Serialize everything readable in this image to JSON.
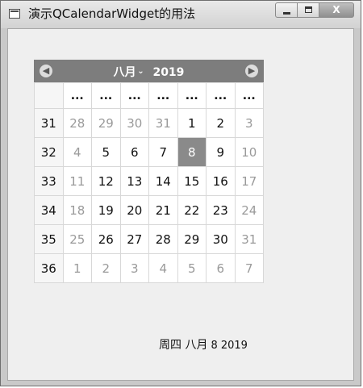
{
  "window": {
    "title": "演示QCalendarWidget的用法",
    "buttons": {
      "minimize": "",
      "maximize": "",
      "close": "X"
    }
  },
  "calendar": {
    "prev_arrow": "◀",
    "next_arrow": "▶",
    "month": "八月",
    "year": "2019",
    "weekday_headers": [
      "...",
      "...",
      "...",
      "...",
      "...",
      "...",
      "..."
    ],
    "weeks": [
      {
        "week": "31",
        "days": [
          {
            "d": "28",
            "o": true
          },
          {
            "d": "29",
            "o": true
          },
          {
            "d": "30",
            "o": true
          },
          {
            "d": "31",
            "o": true
          },
          {
            "d": "1"
          },
          {
            "d": "2"
          },
          {
            "d": "3",
            "o": true
          }
        ]
      },
      {
        "week": "32",
        "days": [
          {
            "d": "4",
            "o": true
          },
          {
            "d": "5"
          },
          {
            "d": "6"
          },
          {
            "d": "7"
          },
          {
            "d": "8",
            "sel": true
          },
          {
            "d": "9"
          },
          {
            "d": "10",
            "o": true
          }
        ]
      },
      {
        "week": "33",
        "days": [
          {
            "d": "11",
            "o": true
          },
          {
            "d": "12"
          },
          {
            "d": "13"
          },
          {
            "d": "14"
          },
          {
            "d": "15"
          },
          {
            "d": "16"
          },
          {
            "d": "17",
            "o": true
          }
        ]
      },
      {
        "week": "34",
        "days": [
          {
            "d": "18",
            "o": true
          },
          {
            "d": "19"
          },
          {
            "d": "20"
          },
          {
            "d": "21"
          },
          {
            "d": "22"
          },
          {
            "d": "23"
          },
          {
            "d": "24",
            "o": true
          }
        ]
      },
      {
        "week": "35",
        "days": [
          {
            "d": "25",
            "o": true
          },
          {
            "d": "26"
          },
          {
            "d": "27"
          },
          {
            "d": "28"
          },
          {
            "d": "29"
          },
          {
            "d": "30"
          },
          {
            "d": "31",
            "o": true
          }
        ]
      },
      {
        "week": "36",
        "days": [
          {
            "d": "1",
            "o": true
          },
          {
            "d": "2",
            "o": true
          },
          {
            "d": "3",
            "o": true
          },
          {
            "d": "4",
            "o": true
          },
          {
            "d": "5",
            "o": true
          },
          {
            "d": "6",
            "o": true
          },
          {
            "d": "7",
            "o": true
          }
        ]
      }
    ]
  },
  "status": {
    "label": "周四 八月",
    "date": "8 2019"
  },
  "colors": {
    "navbar": "#7d7d7d",
    "selected": "#8a8a8a",
    "other_month_text": "#9a9a9a"
  }
}
